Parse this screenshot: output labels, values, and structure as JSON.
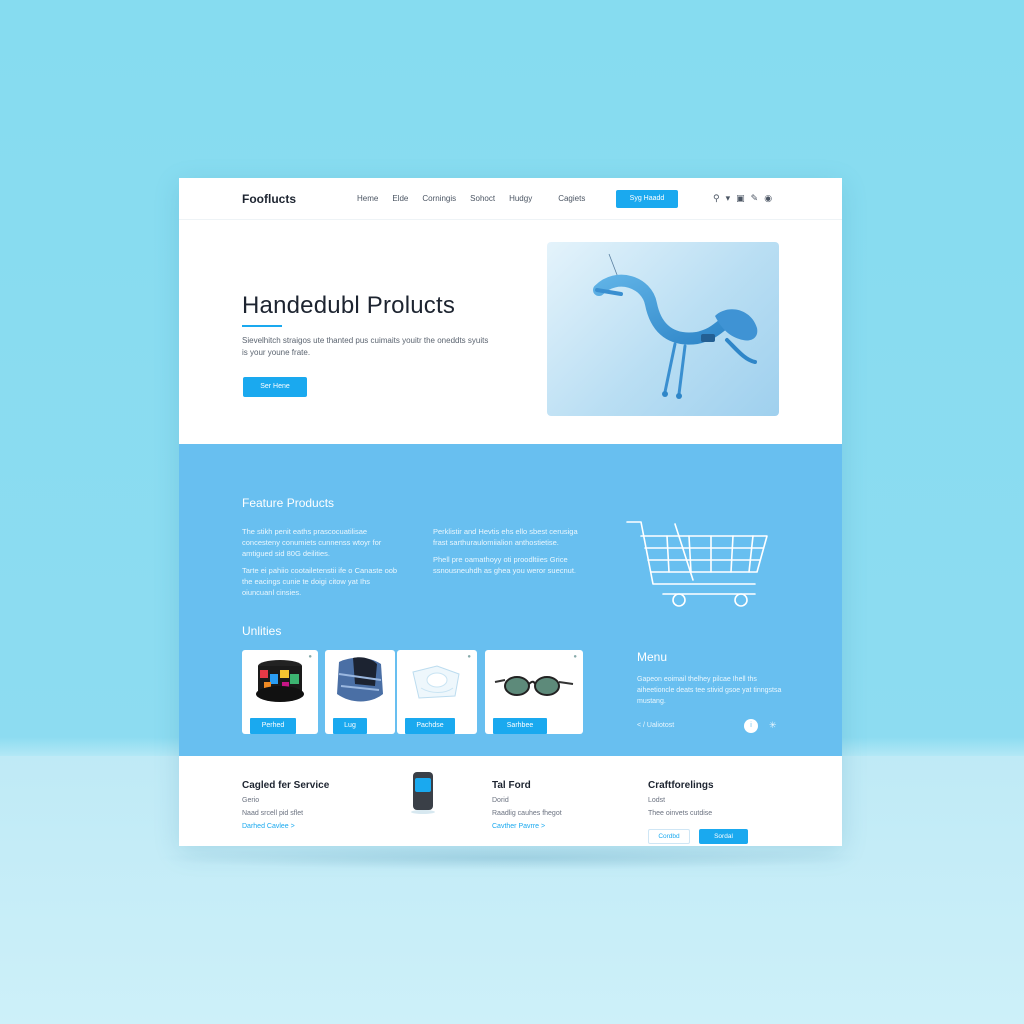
{
  "colors": {
    "accent": "#1aa9ef",
    "section": "#68bff0",
    "backdrop": "#86dcf0"
  },
  "nav": {
    "logo": "Fooflucts",
    "links": [
      "Heme",
      "Elde",
      "Corningis",
      "Sohoct",
      "Hudgy",
      "Cagiets"
    ],
    "cta": "Syg Haadd",
    "icons": [
      "search-icon",
      "filter-icon",
      "bag-icon",
      "edit-icon",
      "lock-icon"
    ]
  },
  "hero": {
    "title": "Handedubl Prolucts",
    "text": "Sievelhitch straigos ute thanted pus cuimaits youitr the oneddts syuits is your youne frate.",
    "button": "Ser Hene"
  },
  "featured": {
    "title": "Feature Products",
    "col1": [
      "The stikh penit eaths prascocuatilisae concesteny conumiets cunnenss wtoyr for amtigued sid 80G deilities.",
      "Tarte ei pahiio cootailetenstii ife o Canaste oob the eacings cunie te doigi citow yat Ihs oiuncuanl cinsies."
    ],
    "col2": [
      "Perklistir and Hevtis ehs ello sbest cerusiga frast sarthuraulomiialion anthostietise.",
      "Phell pre oamathoyy oti proodltiies Grice ssnousneuhdh as ghea you weror suecnut."
    ]
  },
  "utilities": {
    "title": "Unlities",
    "cards": [
      {
        "button": "Perhed",
        "image": "colorful-cap"
      },
      {
        "button": "Lug",
        "image": "scarf"
      },
      {
        "button": "Pachdse",
        "image": "clear-cup"
      },
      {
        "button": "Sarhbee",
        "image": "sunglasses"
      }
    ]
  },
  "menu": {
    "title": "Menu",
    "text": "Gapeon eoimail thelhey pilcae Ihell ths aiheetioncle deats tee stivid gsoe yat tinngstsa mustang.",
    "footer": "< / Ualiotost",
    "dot": "i",
    "dot2": "✳"
  },
  "footer": {
    "col1": {
      "heading": "Cagled fer Service",
      "sub": "Gerio",
      "text": "Naad srcell pid sflet",
      "link": "Darhed Cavlee >"
    },
    "col2": {
      "heading": "Tal Ford",
      "sub": "Dorid",
      "text": "Raadlig cauhes fhegot",
      "link": "Cavther Pavrre >"
    },
    "col3": {
      "heading": "Craftforelings",
      "sub": "Lodst",
      "text": "Thee oinvets cutdise",
      "btn_outline": "Cordbd",
      "btn_fill": "Sordal"
    }
  }
}
